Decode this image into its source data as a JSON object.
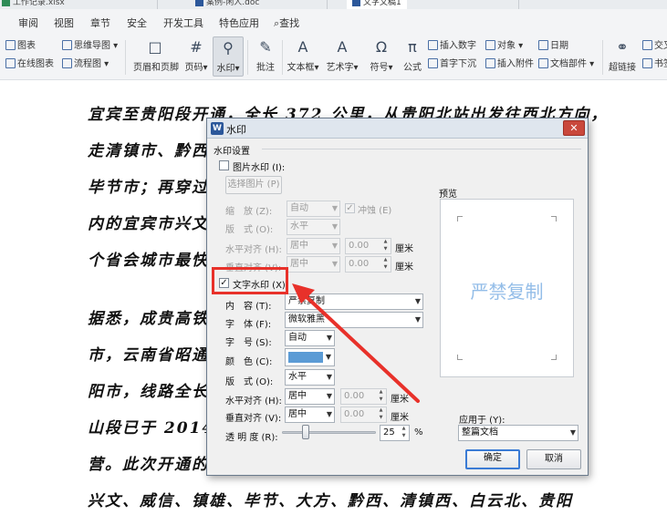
{
  "tabs": [
    {
      "label": "工作记录.xlsx",
      "icon_color": "#2e8b57"
    },
    {
      "label": "案例-闲人.doc",
      "icon_color": "#2b579a"
    },
    {
      "label": "文字文稿1",
      "icon_color": "#2b579a",
      "active": true
    }
  ],
  "menu": [
    "审阅",
    "视图",
    "章节",
    "安全",
    "开发工具",
    "特色应用",
    "查找"
  ],
  "ribbon": {
    "small_left": [
      {
        "label": "图表",
        "icon": "chart-icon"
      },
      {
        "label": "在线图表",
        "icon": "online-chart-icon"
      },
      {
        "label": "思维导图",
        "icon": "mindmap-icon"
      },
      {
        "label": "流程图",
        "icon": "flowchart-icon"
      }
    ],
    "big": [
      {
        "label": "页眉和页脚",
        "icon": "□"
      },
      {
        "label": "页码",
        "icon": "#"
      },
      {
        "label": "水印",
        "icon": "⚲",
        "selected": true
      },
      {
        "label": "批注",
        "icon": "✎"
      },
      {
        "label": "文本框",
        "icon": "A"
      },
      {
        "label": "艺术字",
        "icon": "A"
      },
      {
        "label": "符号",
        "icon": "Ω"
      },
      {
        "label": "公式",
        "icon": "π"
      }
    ],
    "small_right": [
      {
        "label": "插入数字"
      },
      {
        "label": "对象"
      },
      {
        "label": "日期"
      },
      {
        "label": "首字下沉"
      },
      {
        "label": "插入附件"
      },
      {
        "label": "文档部件"
      }
    ],
    "far_right": [
      {
        "label": "超链接"
      },
      {
        "label": "交叉"
      },
      {
        "label": "书签"
      }
    ]
  },
  "document_lines": [
    "宜宾至贵阳段开通，全长 372 公里，从贵阳北站出发往西北方向，",
    "走清镇市、黔西",
    "毕节市；再穿过",
    "内的宜宾市兴文",
    "个省会城市最快",
    "",
    "据悉，成贵高铁",
    "市，云南省昭通",
    "阳市，线路全长",
    "山段已于 2014 年",
    "营。此次开通的",
    "兴文、威信、镇雄、毕节、大方、黔西、清镇西、白云北、贵阳"
  ],
  "dialog": {
    "title": "水印",
    "section_title": "水印设置",
    "picture_watermark": {
      "label": "图片水印 (I):",
      "checked": false,
      "select_button": "选择图片 (P)",
      "scale_label": "缩　放 (Z):",
      "scale_value": "自动",
      "washout_label": "冲蚀 (E)",
      "layout_label": "版　式 (O):",
      "layout_value": "水平",
      "h_align_label": "水平对齐 (H):",
      "h_align_value": "居中",
      "h_offset": "0.00",
      "v_align_label": "垂直对齐 (V):",
      "v_align_value": "居中",
      "v_offset": "0.00",
      "unit": "厘米"
    },
    "text_watermark": {
      "label": "文字水印 (X)",
      "checked": true,
      "content_label": "内　容 (T):",
      "content_value": "严禁复制",
      "font_label": "字　体 (F):",
      "font_value": "微软雅黑",
      "size_label": "字　号 (S):",
      "size_value": "自动",
      "color_label": "颜　色 (C):",
      "color_value": "#5b9bd5",
      "layout_label": "版　式 (O):",
      "layout_value": "水平",
      "h_align_label": "水平对齐 (H):",
      "h_align_value": "居中",
      "h_offset": "0.00",
      "v_align_label": "垂直对齐 (V):",
      "v_align_value": "居中",
      "v_offset": "0.00",
      "unit": "厘米",
      "transparency_label": "透 明 度 (R):",
      "transparency_value": "25",
      "transparency_unit": "%",
      "transparency_level": 0.25
    },
    "preview_label": "预览",
    "preview_text": "严禁复制",
    "apply_to_label": "应用于 (Y):",
    "apply_to_value": "整篇文档",
    "ok": "确定",
    "cancel": "取消"
  },
  "annotation_color": "#e8312a"
}
